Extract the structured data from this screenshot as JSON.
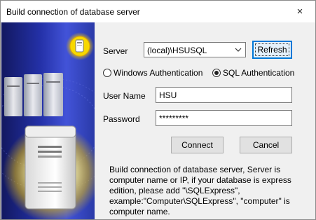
{
  "window": {
    "title": "Build connection of database server",
    "close_glyph": "×"
  },
  "form": {
    "server_label": "Server",
    "server_value": "(local)\\HSUSQL",
    "refresh_label": "Refresh",
    "auth_windows_label": "Windows Authentication",
    "auth_sql_label": "SQL Authentication",
    "auth_selected": "SQL Authentication",
    "username_label": "User Name",
    "username_value": "HSU",
    "password_label": "Password",
    "password_value": "*********",
    "connect_label": "Connect",
    "cancel_label": "Cancel"
  },
  "help_text": "Build connection of database server, Server is computer name or IP, if your database is express edition, please add \"\\SQLExpress\", example:\"Computer\\SQLExpress\", \"computer\" is computer name.",
  "icons": {
    "close": "close-icon",
    "dropdown": "chevron-down-icon",
    "side_art": "server-illustration"
  },
  "colors": {
    "panel_dark": "#121860",
    "panel_mid": "#4253d8",
    "focus_border": "#0078d7",
    "dialog_bg": "#f0f0f0"
  }
}
